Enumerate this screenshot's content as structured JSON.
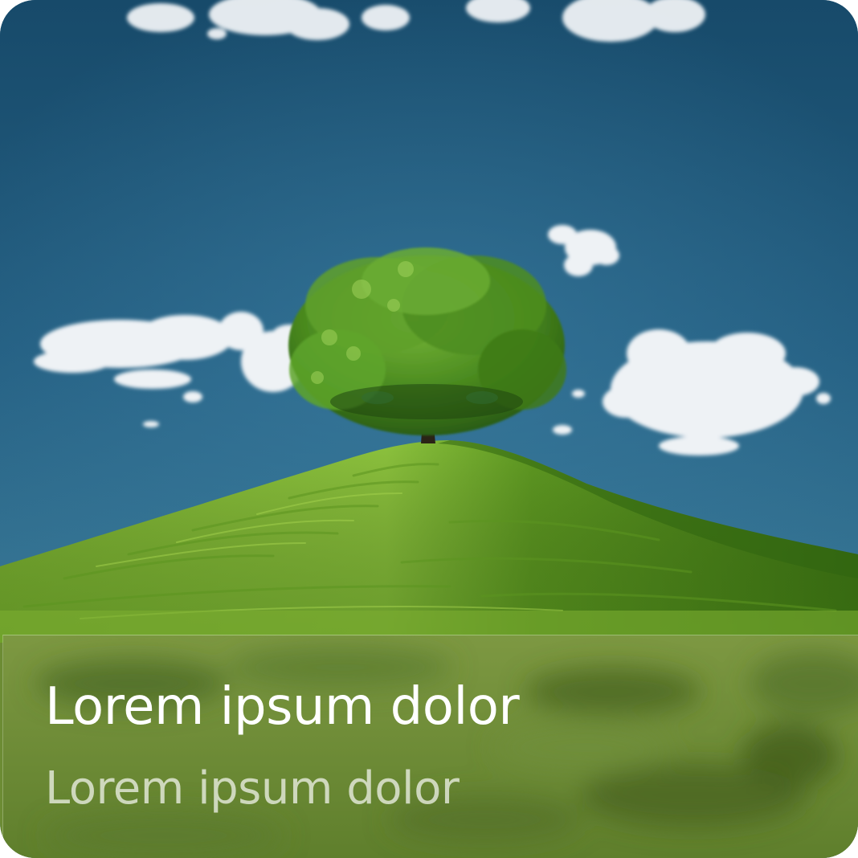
{
  "card": {
    "title": "Lorem ipsum dolor",
    "subtitle": "Lorem ipsum dolor"
  },
  "colors": {
    "sky_top": "#1a4e6e",
    "sky_bottom": "#2f6a8e",
    "grass_light": "#8fc03a",
    "grass_dark": "#3f7a14",
    "foliage": "#4f8f1f",
    "caption_overlay": "#6f8a3a",
    "title_text": "#ffffff",
    "subtitle_text": "#d6dccb"
  }
}
